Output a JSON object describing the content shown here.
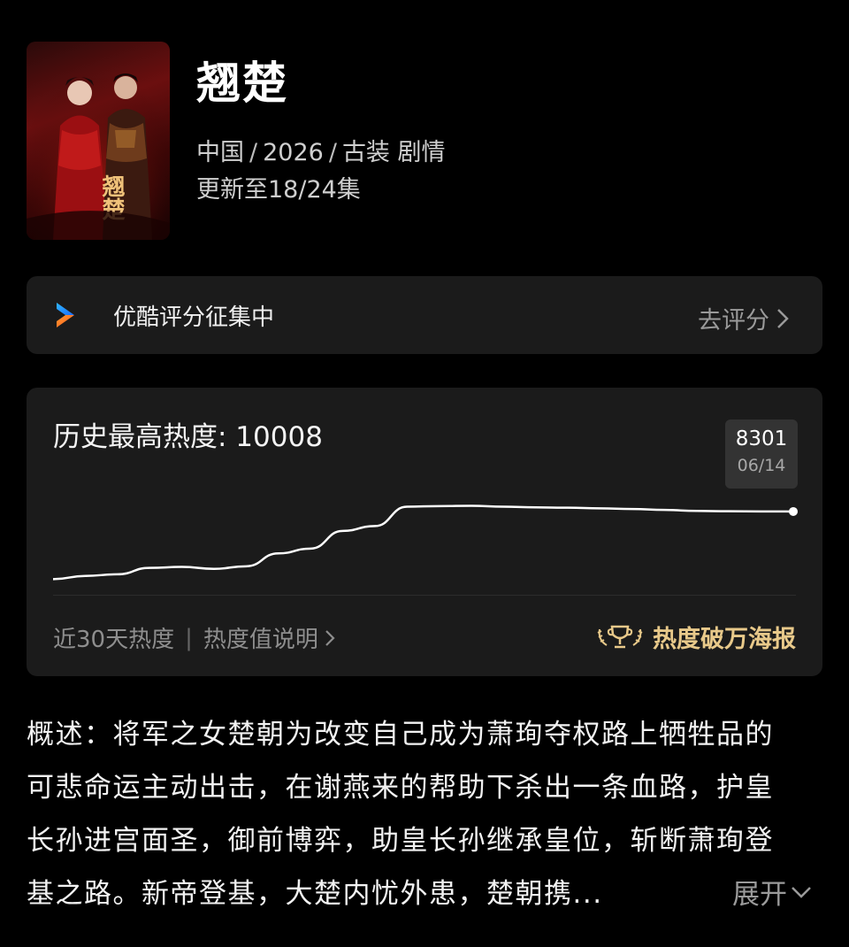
{
  "show": {
    "title": "翘楚",
    "poster_calligraphy": "翘楚",
    "country": "中国",
    "separator": "/",
    "year": "2026",
    "genres": "古装 剧情",
    "episodes": "更新至18/24集"
  },
  "rating": {
    "text": "优酷评分征集中",
    "action": "去评分"
  },
  "heat": {
    "title": "历史最高热度: 10008",
    "tooltip_value": "8301",
    "tooltip_date": "06/14",
    "footer_left": "近30天热度",
    "footer_divider": "|",
    "footer_link": "热度值说明",
    "poster_button": "热度破万海报",
    "accent_color": "#e8c98a"
  },
  "chart_data": {
    "type": "line",
    "title": "",
    "xlabel": "",
    "ylabel": "",
    "highlight": {
      "date": "06/14",
      "value": 8301
    },
    "series": [
      {
        "values": [
          6200,
          6300,
          6350,
          6550,
          6580,
          6520,
          6600,
          7000,
          7150,
          7700,
          7850,
          8450,
          8470,
          8480,
          8450,
          8430,
          8420,
          8400,
          8380,
          8350,
          8320,
          8310,
          8305,
          8301
        ]
      }
    ],
    "ylim": [
      5000,
      10500
    ],
    "grid": false,
    "legend": "none"
  },
  "summary": {
    "lines": [
      "概述：将军之女楚朝为改变自己成为萧珣夺权路上牺牲品的",
      "可悲命运主动出击，在谢燕来的帮助下杀出一条血路，护皇",
      "长孙进宫面圣，御前博弈，助皇长孙继承皇位，斩断萧珣登",
      "基之路。新帝登基，大楚内忧外患，楚朝携..."
    ],
    "expand_label": "展开"
  }
}
